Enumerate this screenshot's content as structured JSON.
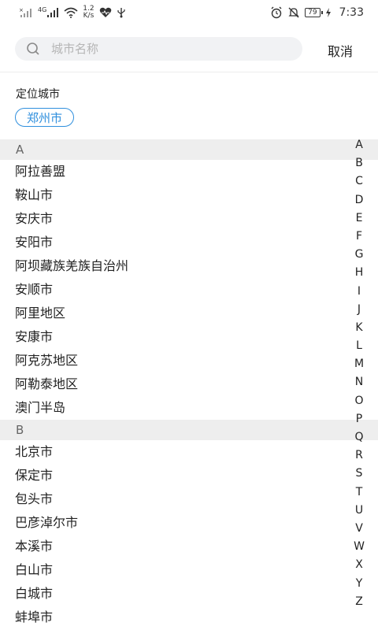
{
  "status_bar": {
    "network_type": "4G",
    "net_speed_value": "1.2",
    "net_speed_unit": "K/s",
    "battery": "79",
    "time": "7:33"
  },
  "search": {
    "placeholder": "城市名称",
    "value": "",
    "cancel_label": "取消"
  },
  "location": {
    "label": "定位城市",
    "current_city": "郑州市"
  },
  "sections": [
    {
      "letter": "A",
      "cities": [
        "阿拉善盟",
        "鞍山市",
        "安庆市",
        "安阳市",
        "阿坝藏族羌族自治州",
        "安顺市",
        "阿里地区",
        "安康市",
        "阿克苏地区",
        "阿勒泰地区",
        "澳门半岛"
      ]
    },
    {
      "letter": "B",
      "cities": [
        "北京市",
        "保定市",
        "包头市",
        "巴彦淖尔市",
        "本溪市",
        "白山市",
        "白城市",
        "蚌埠市"
      ]
    }
  ],
  "alphabet": [
    "A",
    "B",
    "C",
    "D",
    "E",
    "F",
    "G",
    "H",
    "I",
    "J",
    "K",
    "L",
    "M",
    "N",
    "O",
    "P",
    "Q",
    "R",
    "S",
    "T",
    "U",
    "V",
    "W",
    "X",
    "Y",
    "Z"
  ],
  "colors": {
    "accent": "#2f8fdd",
    "section_bg": "#eeeeee",
    "search_bg": "#f1f2f4"
  }
}
